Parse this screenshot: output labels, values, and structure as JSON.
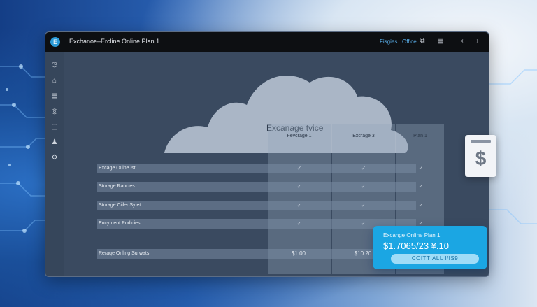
{
  "window": {
    "title": "Exchanoe–Ercline Online Plan 1",
    "links": [
      "Fisgies",
      "Office"
    ],
    "buttons": [
      "▤",
      "‹",
      "›"
    ]
  },
  "sidebar": {
    "icons": [
      "clock-icon",
      "home-icon",
      "document-icon",
      "globe-icon",
      "folder-icon",
      "users-icon",
      "settings-icon"
    ],
    "bottom_icon": "power-icon"
  },
  "comparison": {
    "title": "Excanage tvice",
    "columns": [
      "Fevcrage 1",
      "Excrage 3",
      "Plan 1"
    ],
    "rows": [
      {
        "label": "Excage Oıline ist",
        "checks": [
          "✓",
          "✓",
          "✓"
        ]
      },
      {
        "label": "Storage Rancles",
        "checks": [
          "✓",
          "✓",
          "✓"
        ]
      },
      {
        "label": "Storage Ciiler Sytet",
        "checks": [
          "✓",
          "✓",
          "✓"
        ]
      },
      {
        "label": "Eucyment Podicies",
        "checks": [
          "✓",
          "✓",
          "✓"
        ]
      }
    ],
    "price_row": {
      "label": "Reraqe Onling Surwats",
      "values": [
        "$1.00",
        "$10.20",
        "—"
      ]
    }
  },
  "plan_card": {
    "title": "Excange Online Plan 1",
    "price": "$1.7065/23  ¥.10",
    "button": "COITTIALL I/IS9"
  },
  "doc_card": {
    "symbol": "$"
  },
  "colors": {
    "accent": "#1ba6e3",
    "titlebar": "#0d0f12",
    "window": "#3a4a60"
  }
}
